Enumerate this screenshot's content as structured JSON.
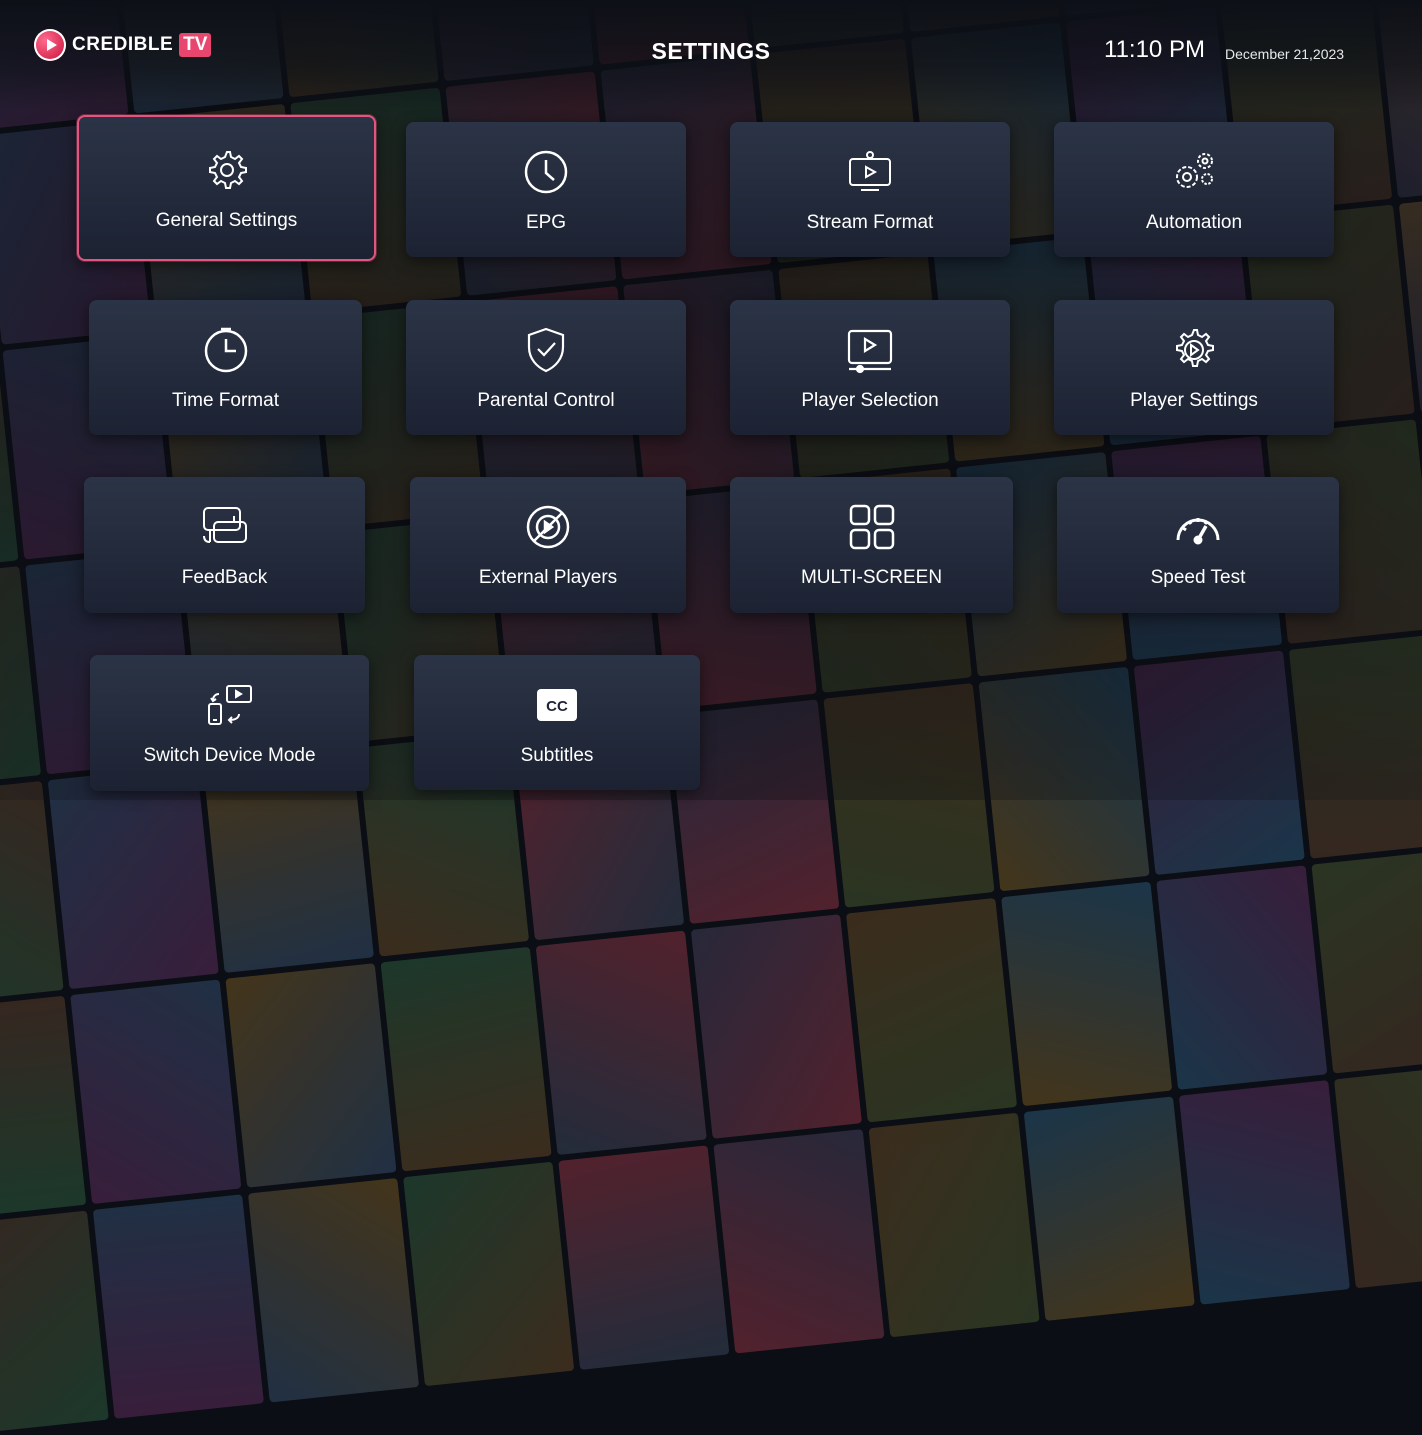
{
  "header": {
    "logo": {
      "word1": "CREDIBLE",
      "word2": "TV"
    },
    "title": "SETTINGS",
    "time": "11:10 PM",
    "date": "December 21,2023"
  },
  "colors": {
    "accent": "#e3557e",
    "tile_top": "#2b3446",
    "tile_bottom": "#1c2232"
  },
  "tiles": [
    {
      "label": "General Settings",
      "icon": "gear-icon",
      "selected": true
    },
    {
      "label": "EPG",
      "icon": "clock-icon"
    },
    {
      "label": "Stream Format",
      "icon": "stream-format-icon"
    },
    {
      "label": "Automation",
      "icon": "automation-gears-icon"
    },
    {
      "label": "Time Format",
      "icon": "time-format-icon"
    },
    {
      "label": "Parental Control",
      "icon": "shield-check-icon"
    },
    {
      "label": "Player Selection",
      "icon": "player-selection-icon"
    },
    {
      "label": "Player Settings",
      "icon": "player-settings-icon"
    },
    {
      "label": "FeedBack",
      "icon": "feedback-chat-icon"
    },
    {
      "label": "External Players",
      "icon": "external-players-icon"
    },
    {
      "label": "MULTI-SCREEN",
      "icon": "multi-screen-grid-icon"
    },
    {
      "label": "Speed Test",
      "icon": "speedometer-icon"
    },
    {
      "label": "Switch Device Mode",
      "icon": "switch-device-icon"
    },
    {
      "label": "Subtitles",
      "icon": "cc-icon"
    }
  ]
}
